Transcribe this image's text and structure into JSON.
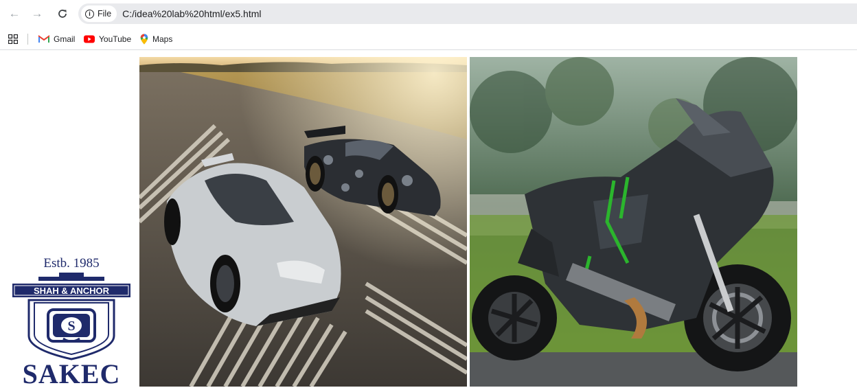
{
  "toolbar": {
    "back_glyph": "←",
    "forward_glyph": "→",
    "reload_glyph": "C",
    "scheme_label": "File",
    "url": "C:/idea%20lab%20html/ex5.html"
  },
  "bookmarks": [
    {
      "label": "Gmail",
      "icon": "gmail-icon"
    },
    {
      "label": "YouTube",
      "icon": "youtube-icon"
    },
    {
      "label": "Maps",
      "icon": "maps-icon"
    }
  ],
  "logo": {
    "established": "Estb. 1985",
    "banner": "SHAH & ANCHOR",
    "monogram": "S",
    "name": "SAKEC"
  },
  "images": [
    {
      "subject": "hypercars on runway"
    },
    {
      "subject": "superbike"
    }
  ],
  "colors": {
    "logo_navy": "#1f2a6b",
    "omnibox_bg": "#e9eaed"
  }
}
